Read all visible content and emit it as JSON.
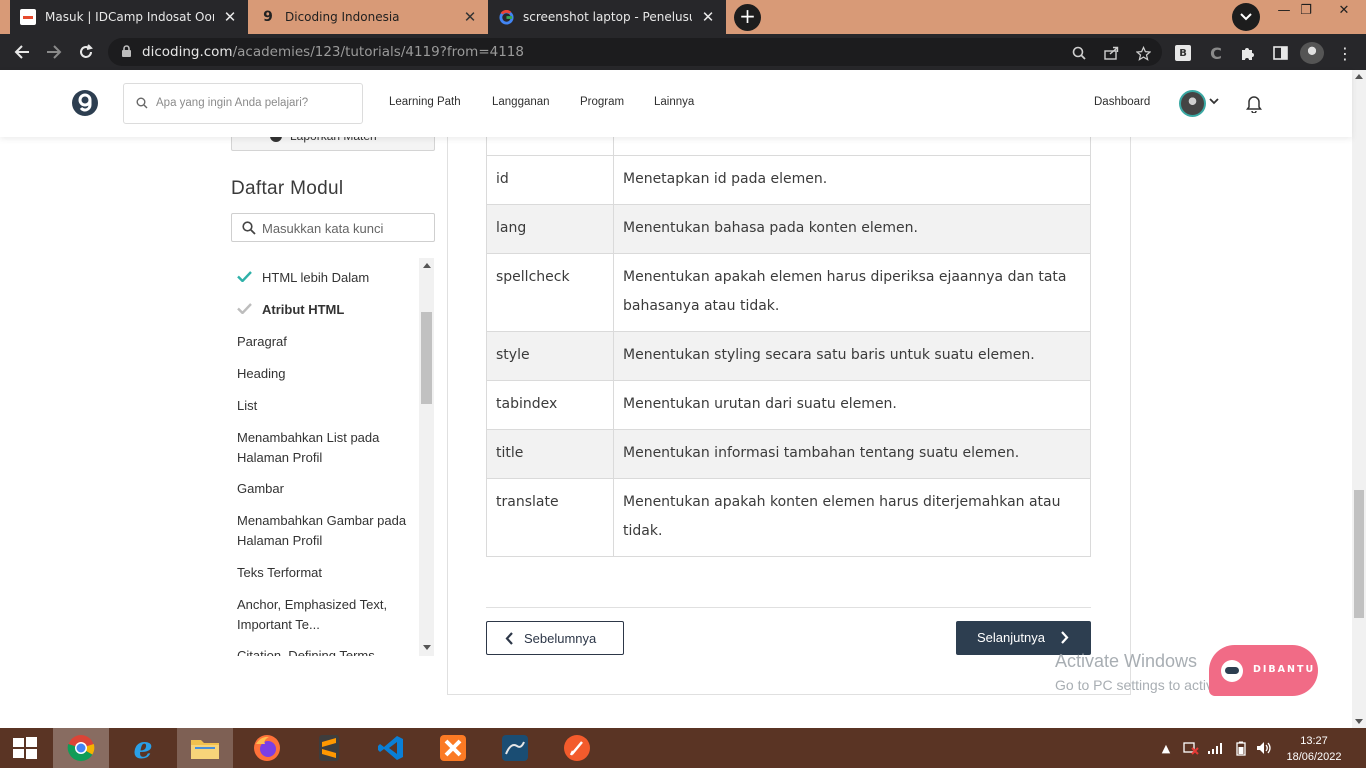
{
  "browser": {
    "tabs": [
      {
        "label": "Masuk | IDCamp Indosat Ooredoo",
        "active": true
      },
      {
        "label": "Dicoding Indonesia",
        "active": false
      },
      {
        "label": "screenshot laptop - Penelusuran Google",
        "active": false
      }
    ],
    "url_host": "dicoding.com",
    "url_path": "/academies/123/tutorials/4119?from=4118",
    "extension_badge": "B"
  },
  "header": {
    "search_placeholder": "Apa yang ingin Anda pelajari?",
    "nav": [
      "Learning Path",
      "Langganan",
      "Program",
      "Lainnya"
    ],
    "dashboard": "Dashboard"
  },
  "sidebar": {
    "report_label": "Laporkan Materi",
    "title": "Daftar Modul",
    "search_placeholder": "Masukkan kata kunci",
    "items": [
      {
        "label": "HTML lebih Dalam",
        "checked": true,
        "done": true
      },
      {
        "label": "Atribut HTML",
        "checked": true,
        "current": true
      },
      {
        "label": "Paragraf"
      },
      {
        "label": "Heading"
      },
      {
        "label": "List"
      },
      {
        "label": "Menambahkan List pada Halaman Profil"
      },
      {
        "label": "Gambar"
      },
      {
        "label": "Menambahkan Gambar pada Halaman Profil"
      },
      {
        "label": "Teks Terformat"
      },
      {
        "label": "Anchor, Emphasized Text, Important Te..."
      },
      {
        "label": "Citation, Defining Terms..."
      }
    ]
  },
  "table": {
    "rows": [
      {
        "attr": "",
        "desc": ""
      },
      {
        "attr": "id",
        "desc": "Menetapkan id pada elemen."
      },
      {
        "attr": "lang",
        "desc": "Menentukan bahasa pada konten elemen."
      },
      {
        "attr": "spellcheck",
        "desc": "Menentukan apakah elemen harus diperiksa ejaannya dan tata bahasanya atau tidak."
      },
      {
        "attr": "style",
        "desc": "Menentukan styling secara satu baris untuk suatu elemen."
      },
      {
        "attr": "tabindex",
        "desc": "Menentukan urutan dari suatu elemen."
      },
      {
        "attr": "title",
        "desc": "Menentukan informasi tambahan tentang suatu elemen."
      },
      {
        "attr": "translate",
        "desc": "Menentukan apakah konten elemen harus diterjemahkan atau tidak."
      }
    ]
  },
  "pager": {
    "prev": "Sebelumnya",
    "next": "Selanjutnya"
  },
  "overlay": {
    "watermark_title": "Activate Windows",
    "watermark_sub": "Go to PC settings to activate Windows.",
    "help_button": "DIBANTU"
  },
  "taskbar": {
    "time": "13:27",
    "date": "18/06/2022"
  },
  "colors": {
    "tab_strip": "#d89a77",
    "chrome_dark": "#27272a",
    "brand_dark": "#2d3e50",
    "check_teal": "#2fb1a9",
    "help_pink": "#f16b86",
    "taskbar": "#5a3424"
  }
}
